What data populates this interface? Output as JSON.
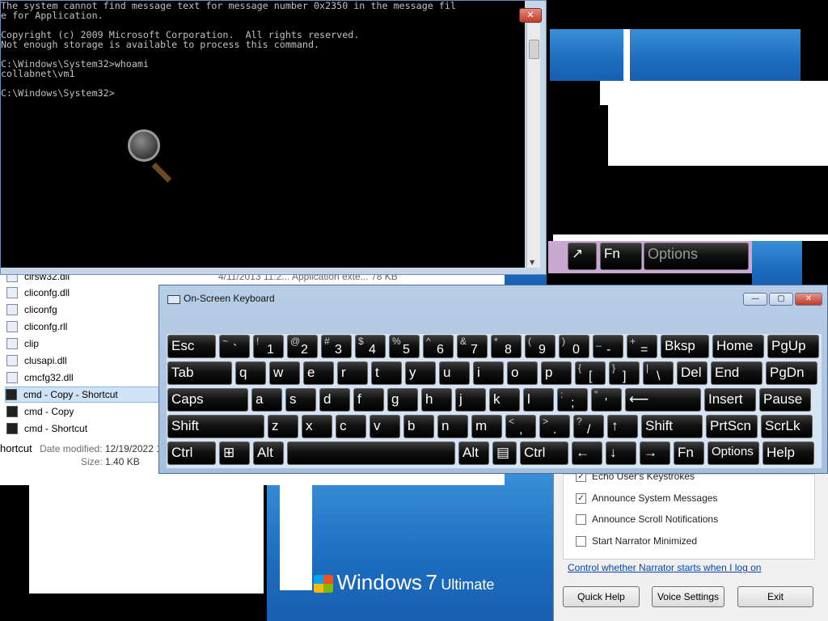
{
  "cmd": {
    "lines": [
      "The system cannot find message text for message number 0x2350 in the message fil",
      "e for Application.",
      "",
      "Copyright (c) 2009 Microsoft Corporation.  All rights reserved.",
      "Not enough storage is available to process this command.",
      "",
      "C:\\Windows\\System32>whoami",
      "collabnet\\vm1",
      "",
      "C:\\Windows\\System32>"
    ],
    "close_glyph": "✕"
  },
  "explorer": {
    "files": [
      {
        "name": "clrsw32.dll",
        "icon": "dll-icon"
      },
      {
        "name": "cliconfg.dll",
        "icon": "dll-icon"
      },
      {
        "name": "cliconfg",
        "icon": "app-icon"
      },
      {
        "name": "cliconfg.rll",
        "icon": "dll-icon"
      },
      {
        "name": "clip",
        "icon": "app-icon"
      },
      {
        "name": "clusapi.dll",
        "icon": "dll-icon"
      },
      {
        "name": "cmcfg32.dll",
        "icon": "dll-icon"
      },
      {
        "name": "cmd - Copy - Shortcut",
        "icon": "cmd-icon"
      },
      {
        "name": "cmd - Copy",
        "icon": "cmd-icon"
      },
      {
        "name": "cmd - Shortcut",
        "icon": "cmd-icon"
      }
    ],
    "details_name": "hortcut",
    "date_label": "Date modified:",
    "date_value": "12/19/2022 1",
    "size_label": "Size:",
    "size_value": "1.40 KB",
    "partial_row": "4/11/2013 11:2...    Application exte...    78 KB"
  },
  "osk": {
    "title": "On-Screen Keyboard",
    "rows": [
      [
        {
          "m": "Esc"
        },
        {
          "t": "~",
          "b": "`"
        },
        {
          "t": "!",
          "b": "1"
        },
        {
          "t": "@",
          "b": "2"
        },
        {
          "t": "#",
          "b": "3"
        },
        {
          "t": "$",
          "b": "4"
        },
        {
          "t": "%",
          "b": "5"
        },
        {
          "t": "^",
          "b": "6"
        },
        {
          "t": "&",
          "b": "7"
        },
        {
          "t": "*",
          "b": "8"
        },
        {
          "t": "(",
          "b": "9"
        },
        {
          "t": ")",
          "b": "0"
        },
        {
          "t": "_",
          "b": "-"
        },
        {
          "t": "+",
          "b": "="
        },
        {
          "m": "Bksp"
        },
        {
          "m": "Home"
        },
        {
          "m": "PgUp"
        }
      ],
      [
        {
          "m": "Tab"
        },
        {
          "m": "q"
        },
        {
          "m": "w"
        },
        {
          "m": "e"
        },
        {
          "m": "r"
        },
        {
          "m": "t"
        },
        {
          "m": "y"
        },
        {
          "m": "u"
        },
        {
          "m": "i"
        },
        {
          "m": "o"
        },
        {
          "m": "p"
        },
        {
          "t": "{",
          "b": "["
        },
        {
          "t": "}",
          "b": "]"
        },
        {
          "t": "|",
          "b": "\\"
        },
        {
          "m": "Del"
        },
        {
          "m": "End"
        },
        {
          "m": "PgDn"
        }
      ],
      [
        {
          "m": "Caps"
        },
        {
          "m": "a"
        },
        {
          "m": "s"
        },
        {
          "m": "d"
        },
        {
          "m": "f"
        },
        {
          "m": "g"
        },
        {
          "m": "h"
        },
        {
          "m": "j"
        },
        {
          "m": "k"
        },
        {
          "m": "l"
        },
        {
          "t": ":",
          "b": ";"
        },
        {
          "t": "\"",
          "b": "'"
        },
        {
          "m": "⟵"
        },
        {
          "m": "Insert"
        },
        {
          "m": "Pause"
        }
      ],
      [
        {
          "m": "Shift"
        },
        {
          "m": "z"
        },
        {
          "m": "x"
        },
        {
          "m": "c"
        },
        {
          "m": "v"
        },
        {
          "m": "b"
        },
        {
          "m": "n"
        },
        {
          "m": "m"
        },
        {
          "t": "<",
          "b": ","
        },
        {
          "t": ">",
          "b": "."
        },
        {
          "t": "?",
          "b": "/"
        },
        {
          "m": "↑"
        },
        {
          "m": "Shift"
        },
        {
          "m": "PrtScn"
        },
        {
          "m": "ScrLk"
        }
      ],
      [
        {
          "m": "Ctrl"
        },
        {
          "m": "⊞"
        },
        {
          "m": "Alt"
        },
        {
          "m": ""
        },
        {
          "m": "Alt"
        },
        {
          "m": "▤"
        },
        {
          "m": "Ctrl"
        },
        {
          "m": "←"
        },
        {
          "m": "↓"
        },
        {
          "m": "→"
        },
        {
          "m": "Fn"
        },
        {
          "m": "Options"
        },
        {
          "m": "Help"
        }
      ]
    ]
  },
  "background_osk": {
    "fn_label": "Fn",
    "options_label": "Options"
  },
  "narrator": {
    "checkboxes": [
      {
        "label": "Echo User's Keystrokes",
        "checked": true
      },
      {
        "label": "Announce System Messages",
        "checked": true
      },
      {
        "label": "Announce Scroll Notifications",
        "checked": false
      },
      {
        "label": "Start Narrator Minimized",
        "checked": false
      }
    ],
    "link": "Control whether Narrator starts when I log on",
    "buttons": {
      "help": "Quick Help",
      "voice": "Voice Settings",
      "exit": "Exit"
    }
  },
  "desktop": {
    "brand": "Windows",
    "version": "7",
    "edition": "Ultimate"
  },
  "colors": {
    "desktop_blue": "#1c6cc0",
    "osk_frame": "#b8cde6",
    "selection": "#cfe3f8"
  }
}
